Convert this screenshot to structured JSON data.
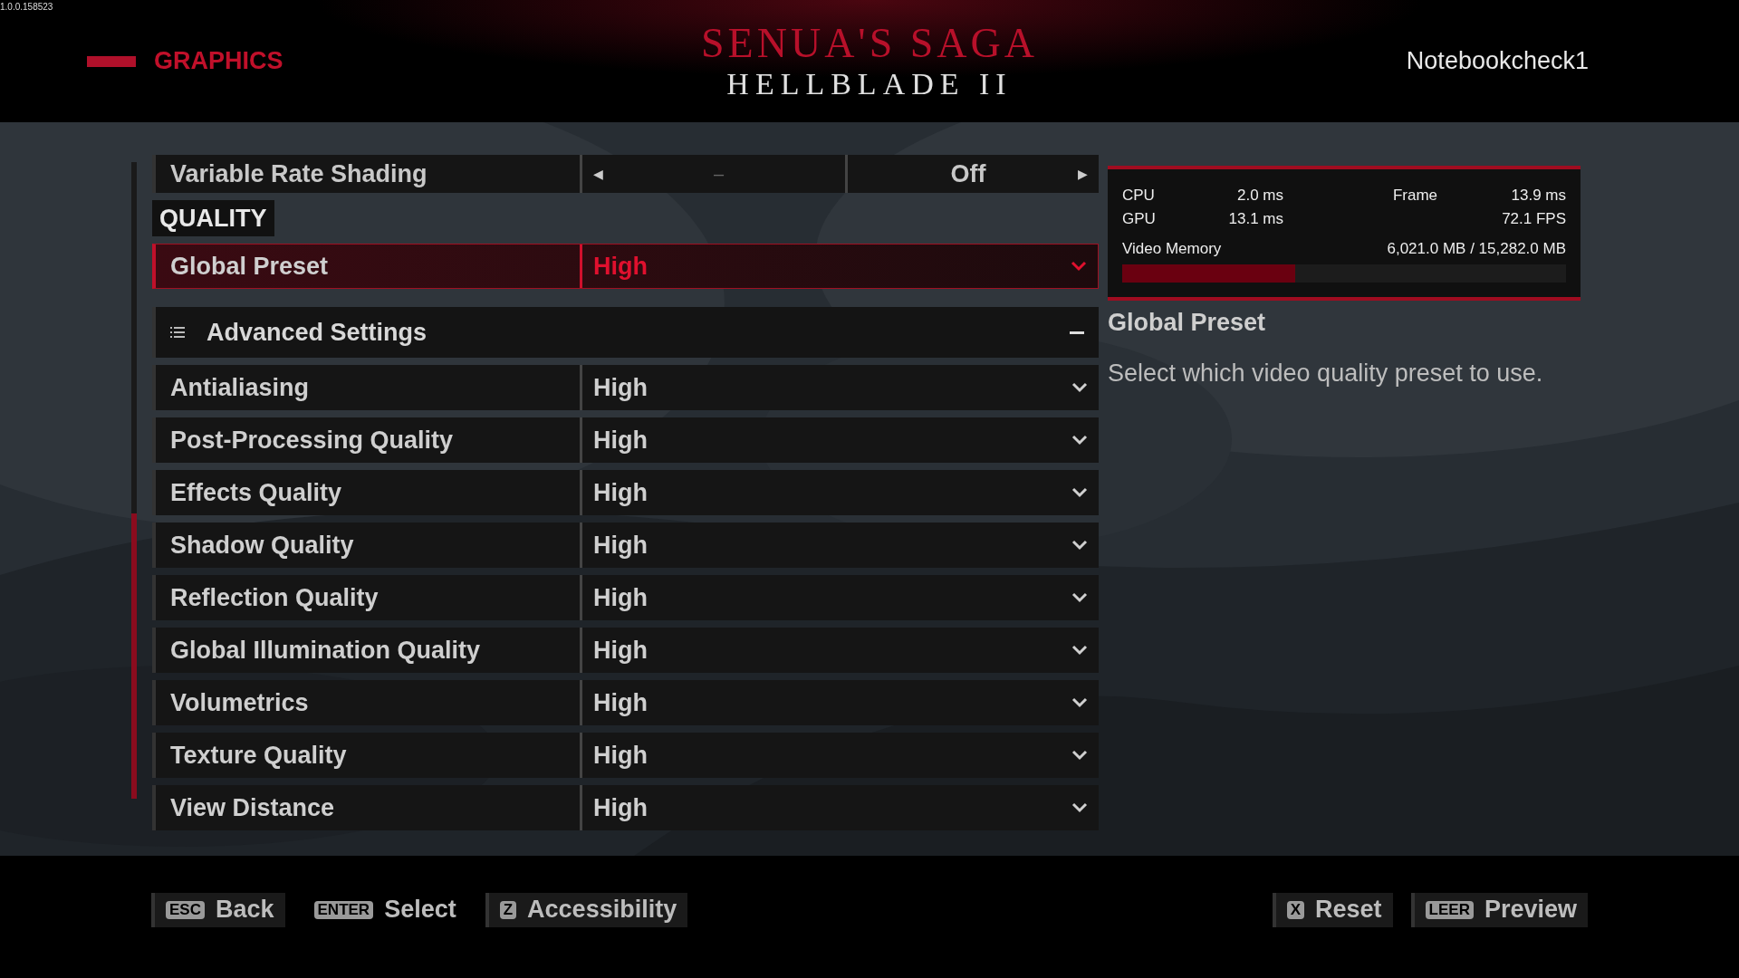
{
  "version": "1.0.0.158523",
  "header": {
    "section": "GRAPHICS",
    "logo_title": "SENUA'S SAGA",
    "logo_subtitle": "HELLBLADE II",
    "user": "Notebookcheck1"
  },
  "settings": [
    {
      "kind": "selector",
      "label": "Variable Rate Shading",
      "middle": "–",
      "value": "Off",
      "left": "◀",
      "right": "▶",
      "selected": false
    },
    {
      "kind": "heading",
      "label": "QUALITY"
    },
    {
      "kind": "dropdown",
      "label": "Global Preset",
      "value": "High",
      "selected": true
    },
    {
      "kind": "group",
      "label": "Advanced Settings",
      "expanded": true
    },
    {
      "kind": "dropdown",
      "label": "Antialiasing",
      "value": "High",
      "selected": false
    },
    {
      "kind": "dropdown",
      "label": "Post-Processing Quality",
      "value": "High",
      "selected": false
    },
    {
      "kind": "dropdown",
      "label": "Effects Quality",
      "value": "High",
      "selected": false
    },
    {
      "kind": "dropdown",
      "label": "Shadow Quality",
      "value": "High",
      "selected": false
    },
    {
      "kind": "dropdown",
      "label": "Reflection Quality",
      "value": "High",
      "selected": false
    },
    {
      "kind": "dropdown",
      "label": "Global Illumination Quality",
      "value": "High",
      "selected": false
    },
    {
      "kind": "dropdown",
      "label": "Volumetrics",
      "value": "High",
      "selected": false
    },
    {
      "kind": "dropdown",
      "label": "Texture Quality",
      "value": "High",
      "selected": false
    },
    {
      "kind": "dropdown",
      "label": "View Distance",
      "value": "High",
      "selected": false
    }
  ],
  "stats": {
    "cpu_label": "CPU",
    "cpu": "2.0 ms",
    "gpu_label": "GPU",
    "gpu": "13.1 ms",
    "frame_label": "Frame",
    "frame": "13.9 ms",
    "fps": "72.1 FPS",
    "memory_label": "Video Memory",
    "memory": "6,021.0 MB / 15,282.0 MB",
    "level": 0.39
  },
  "help": {
    "title": "Global Preset",
    "text": "Select which video quality preset to use."
  },
  "footer_left": [
    {
      "key": "ESC",
      "label": "Back",
      "framed": true
    },
    {
      "key": "ENTER",
      "label": "Select",
      "framed": false
    },
    {
      "key": "Z",
      "label": "Accessibility",
      "framed": true
    }
  ],
  "footer_right": [
    {
      "key": "X",
      "label": "Reset",
      "framed": true
    },
    {
      "key": "LEER",
      "label": "Preview",
      "framed": true
    }
  ]
}
